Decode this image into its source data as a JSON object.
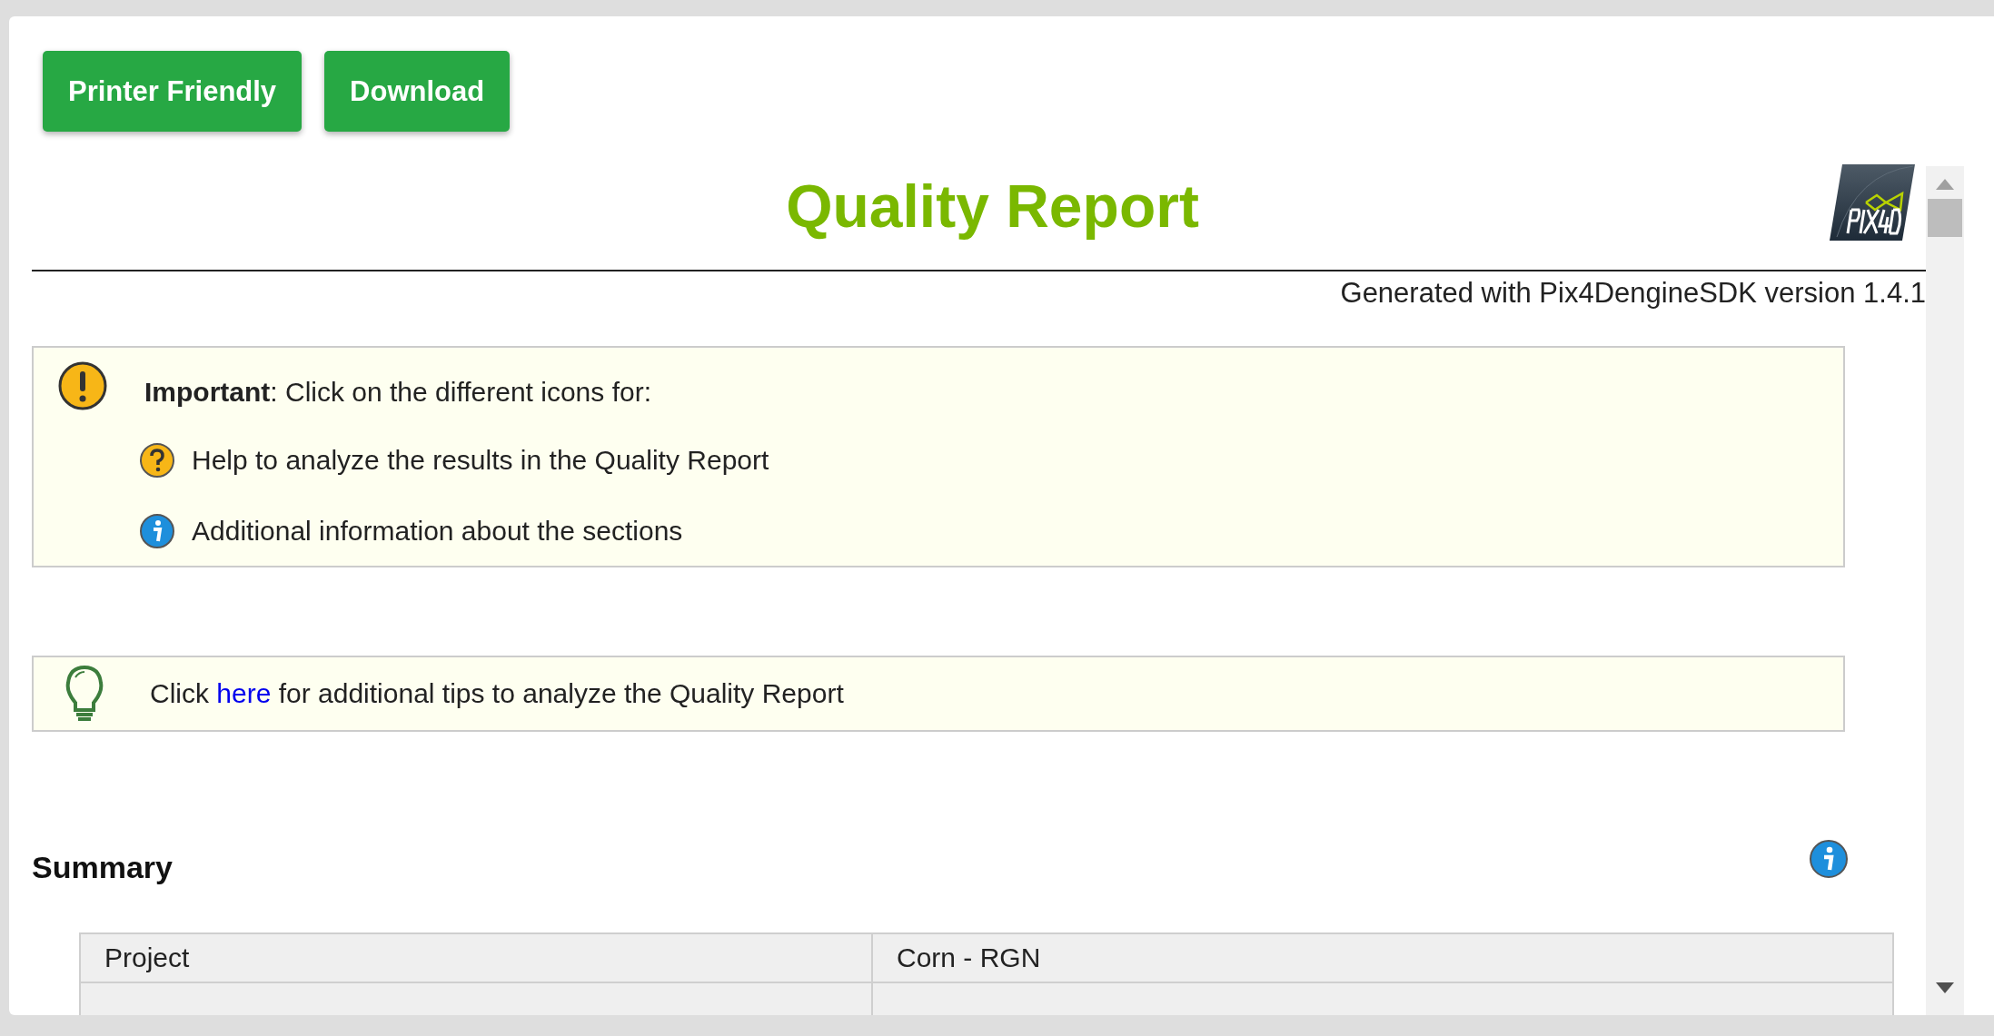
{
  "toolbar": {
    "buttons": [
      "Printer Friendly",
      "Download"
    ]
  },
  "report": {
    "title": "Quality Report",
    "generated": "Generated with Pix4DengineSDK version 1.4.1"
  },
  "important": {
    "text": "**Important**: Click on the different icons for:",
    "items": [
      {
        "kind": "help",
        "text": "Help to analyze the results in the Quality Report"
      },
      {
        "kind": "info",
        "text": "Additional information about the sections"
      }
    ]
  },
  "tips": {
    "before": "Click ",
    "link": "here",
    "after": " for additional tips to analyze the Quality Report"
  },
  "summary": {
    "heading": "Summary",
    "rows": [
      [
        "Project",
        "Corn - RGN"
      ]
    ]
  }
}
